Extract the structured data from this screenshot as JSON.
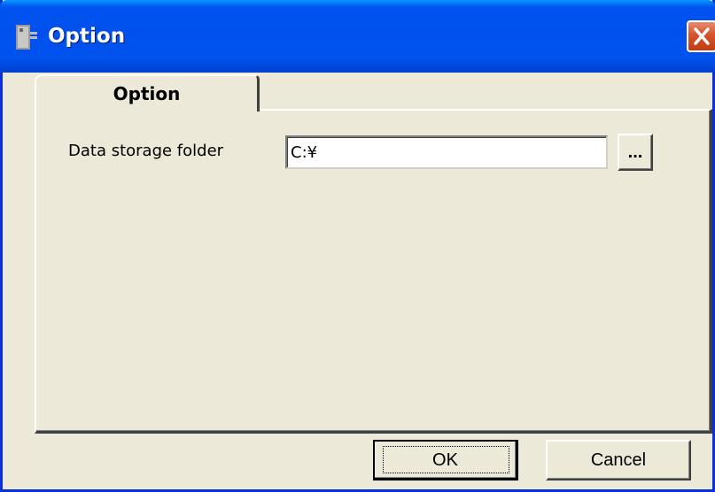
{
  "window": {
    "title": "Option",
    "icon": "application-icon",
    "close_icon": "close-icon"
  },
  "tabs": [
    {
      "label": "Option",
      "selected": true
    }
  ],
  "form": {
    "data_storage_label": "Data storage folder",
    "data_storage_value": "C:¥",
    "browse_label": "..."
  },
  "buttons": {
    "ok_label": "OK",
    "cancel_label": "Cancel"
  },
  "colors": {
    "titlebar": "#0053ee",
    "close_button": "#d6532b",
    "dialog_background": "#ece9d8"
  }
}
